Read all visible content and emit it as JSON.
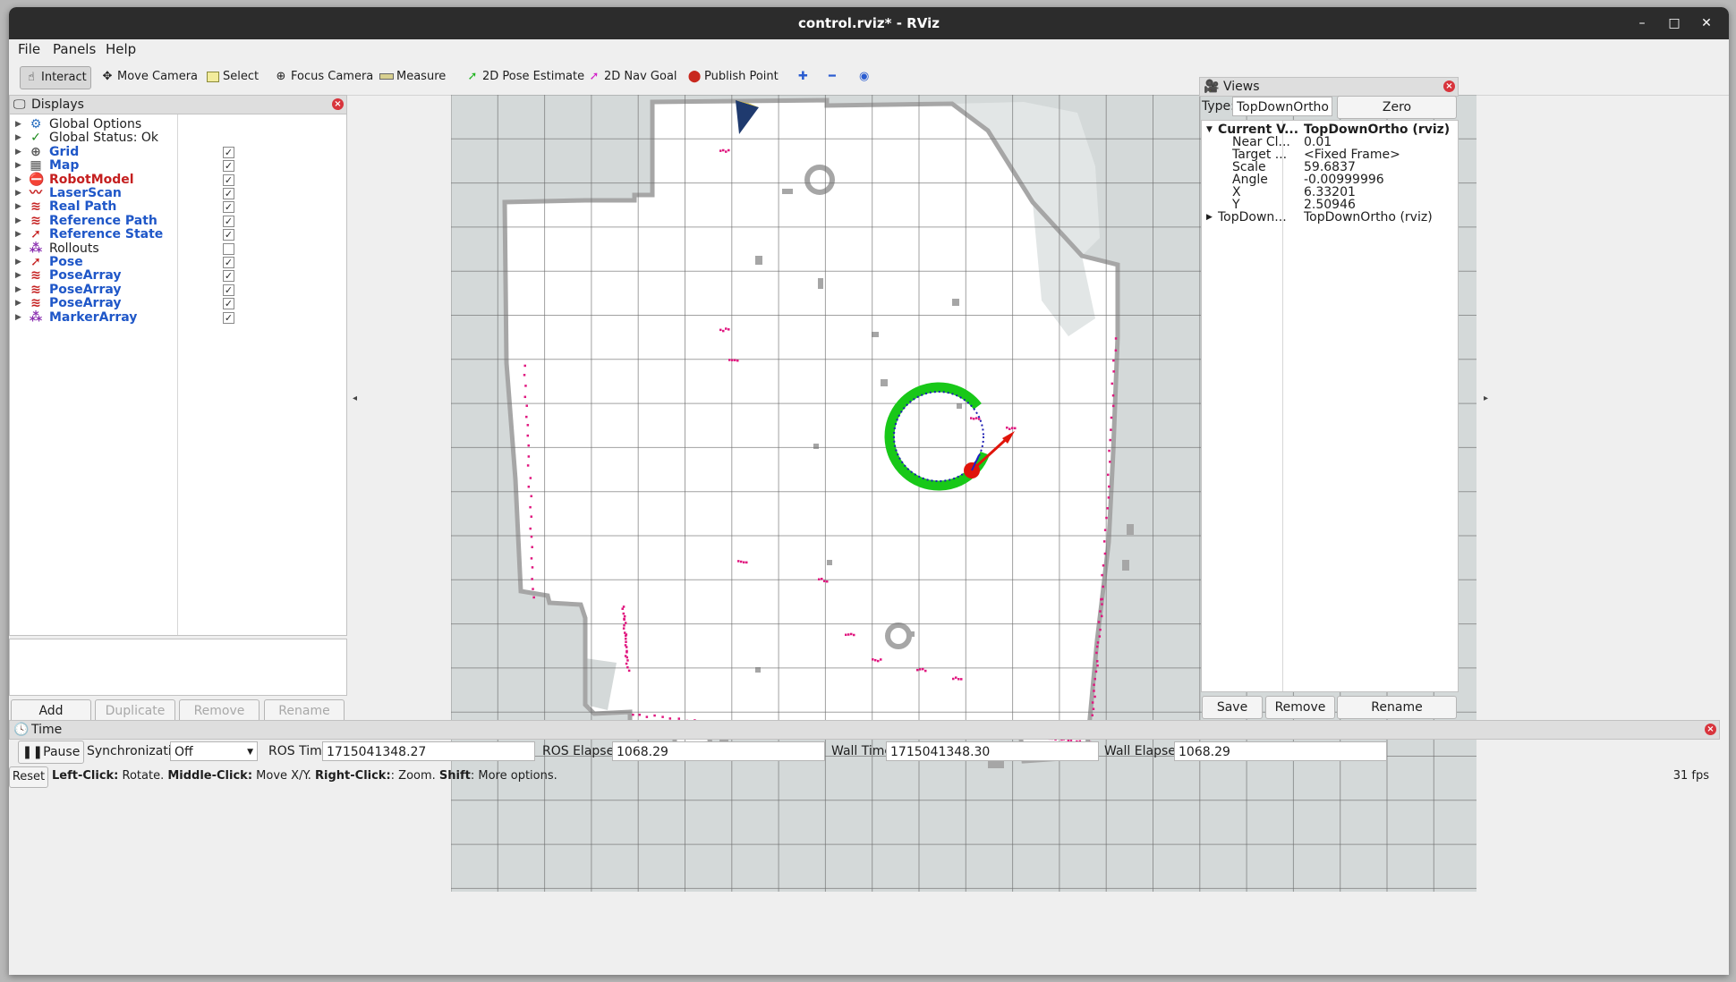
{
  "window": {
    "title": "control.rviz* - RViz",
    "minimize": "–",
    "maximize": "□",
    "close": "✕"
  },
  "menu": [
    "File",
    "Panels",
    "Help"
  ],
  "toolbar": [
    {
      "label": "Interact",
      "icon": "hand-icon",
      "active": true
    },
    {
      "label": "Move Camera",
      "icon": "move-camera-icon"
    },
    {
      "label": "Select",
      "icon": "select-icon"
    },
    {
      "label": "Focus Camera",
      "icon": "focus-camera-icon"
    },
    {
      "label": "Measure",
      "icon": "measure-icon"
    },
    {
      "label": "2D Pose Estimate",
      "icon": "pose-estimate-icon"
    },
    {
      "label": "2D Nav Goal",
      "icon": "nav-goal-icon"
    },
    {
      "label": "Publish Point",
      "icon": "publish-point-icon"
    }
  ],
  "toolbar_extra_icons": [
    "plus-icon",
    "minus-icon",
    "eye-icon"
  ],
  "displays": {
    "title": "Displays",
    "items": [
      {
        "label": "Global Options",
        "icon": "gear-icon",
        "style": "normal"
      },
      {
        "label": "Global Status: Ok",
        "icon": "check-icon",
        "style": "normal"
      },
      {
        "label": "Grid",
        "icon": "grid-icon",
        "style": "blue",
        "checked": true
      },
      {
        "label": "Map",
        "icon": "map-icon",
        "style": "blue",
        "checked": true
      },
      {
        "label": "RobotModel",
        "icon": "error-icon",
        "style": "red",
        "checked": true
      },
      {
        "label": "LaserScan",
        "icon": "laserscan-icon",
        "style": "blue",
        "checked": true
      },
      {
        "label": "Real Path",
        "icon": "path-icon",
        "style": "blue",
        "checked": true
      },
      {
        "label": "Reference Path",
        "icon": "path-icon",
        "style": "blue",
        "checked": true
      },
      {
        "label": "Reference State",
        "icon": "pose-icon",
        "style": "blue",
        "checked": true
      },
      {
        "label": "Rollouts",
        "icon": "marker-icon",
        "style": "normal",
        "checked": false
      },
      {
        "label": "Pose",
        "icon": "pose-icon",
        "style": "blue",
        "checked": true
      },
      {
        "label": "PoseArray",
        "icon": "path-icon",
        "style": "blue",
        "checked": true
      },
      {
        "label": "PoseArray",
        "icon": "path-icon",
        "style": "blue",
        "checked": true
      },
      {
        "label": "PoseArray",
        "icon": "path-icon",
        "style": "blue",
        "checked": true
      },
      {
        "label": "MarkerArray",
        "icon": "marker-icon",
        "style": "blue",
        "checked": true
      }
    ],
    "buttons": {
      "add": "Add",
      "duplicate": "Duplicate",
      "remove": "Remove",
      "rename": "Rename"
    }
  },
  "views": {
    "title": "Views",
    "type_label": "Type:",
    "type_value": "TopDownOrtho (",
    "zero": "Zero",
    "properties": [
      {
        "key": "Current V...",
        "value": "TopDownOrtho (rviz)",
        "bold": true,
        "expanded": true
      },
      {
        "key": "Near Cl...",
        "value": "0.01"
      },
      {
        "key": "Target ...",
        "value": "<Fixed Frame>"
      },
      {
        "key": "Scale",
        "value": "59.6837"
      },
      {
        "key": "Angle",
        "value": "-0.00999996"
      },
      {
        "key": "X",
        "value": "6.33201"
      },
      {
        "key": "Y",
        "value": "2.50946"
      },
      {
        "key": "TopDown...",
        "value": "TopDownOrtho (rviz)",
        "collapsed": true
      }
    ],
    "buttons": {
      "save": "Save",
      "remove": "Remove",
      "rename": "Rename"
    }
  },
  "time": {
    "title": "Time",
    "pause": "Pause",
    "sync_label": "Synchronization:",
    "sync_value": "Off",
    "ros_time_label": "ROS Time:",
    "ros_time": "1715041348.27",
    "ros_elapsed_label": "ROS Elapsed:",
    "ros_elapsed": "1068.29",
    "wall_time_label": "Wall Time:",
    "wall_time": "1715041348.30",
    "wall_elapsed_label": "Wall Elapsed:",
    "wall_elapsed": "1068.29"
  },
  "status": {
    "reset": "Reset",
    "b1": "Left-Click:",
    "t1": " Rotate. ",
    "b2": "Middle-Click:",
    "t2": " Move X/Y. ",
    "b3": "Right-Click:",
    "t3": ": Zoom. ",
    "b4": "Shift",
    "t4": ": More options.",
    "fps": "31 fps"
  },
  "colors": {
    "grid_line": "#6e6e6e",
    "free_space": "#ffffff",
    "unknown": "#d4d9d9",
    "obstacle": "#a6a6a6",
    "laser": "#e0177f",
    "path_green": "#18c818",
    "path_blue": "#1e1eb4",
    "pose_red": "#e0140a"
  }
}
